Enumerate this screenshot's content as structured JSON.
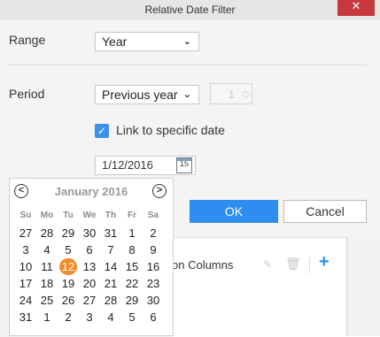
{
  "window": {
    "title": "Relative Date Filter",
    "close_glyph": "✕"
  },
  "form": {
    "range_label": "Range",
    "range_value": "Year",
    "period_label": "Period",
    "period_value": "Previous year",
    "spinner_value": "1",
    "link_label": "Link to specific date",
    "link_checked": true,
    "date_value": "1/12/2016",
    "calendar_icon_text": "15"
  },
  "buttons": {
    "ok": "OK",
    "cancel": "Cancel"
  },
  "background_panel": {
    "columns_label": "on Columns"
  },
  "calendar": {
    "month_label": "January 2016",
    "weekdays": [
      "Su",
      "Mo",
      "Tu",
      "We",
      "Th",
      "Fr",
      "Sa"
    ],
    "weeks": [
      [
        "27",
        "28",
        "29",
        "30",
        "31",
        "1",
        "2"
      ],
      [
        "3",
        "4",
        "5",
        "6",
        "7",
        "8",
        "9"
      ],
      [
        "10",
        "11",
        "12",
        "13",
        "14",
        "15",
        "16"
      ],
      [
        "17",
        "18",
        "19",
        "20",
        "21",
        "22",
        "23"
      ],
      [
        "24",
        "25",
        "26",
        "27",
        "28",
        "29",
        "30"
      ],
      [
        "31",
        "1",
        "2",
        "3",
        "4",
        "5",
        "6"
      ]
    ],
    "selected_day": "12",
    "selected_color": "#f38a2a"
  },
  "colors": {
    "accent": "#2e8ef0",
    "close": "#c8393d"
  },
  "icons": {
    "prev": "chevron-left-icon",
    "next": "chevron-right-icon",
    "calendar": "calendar-icon",
    "edit": "pencil-icon",
    "delete": "trash-icon",
    "add": "plus-icon"
  }
}
